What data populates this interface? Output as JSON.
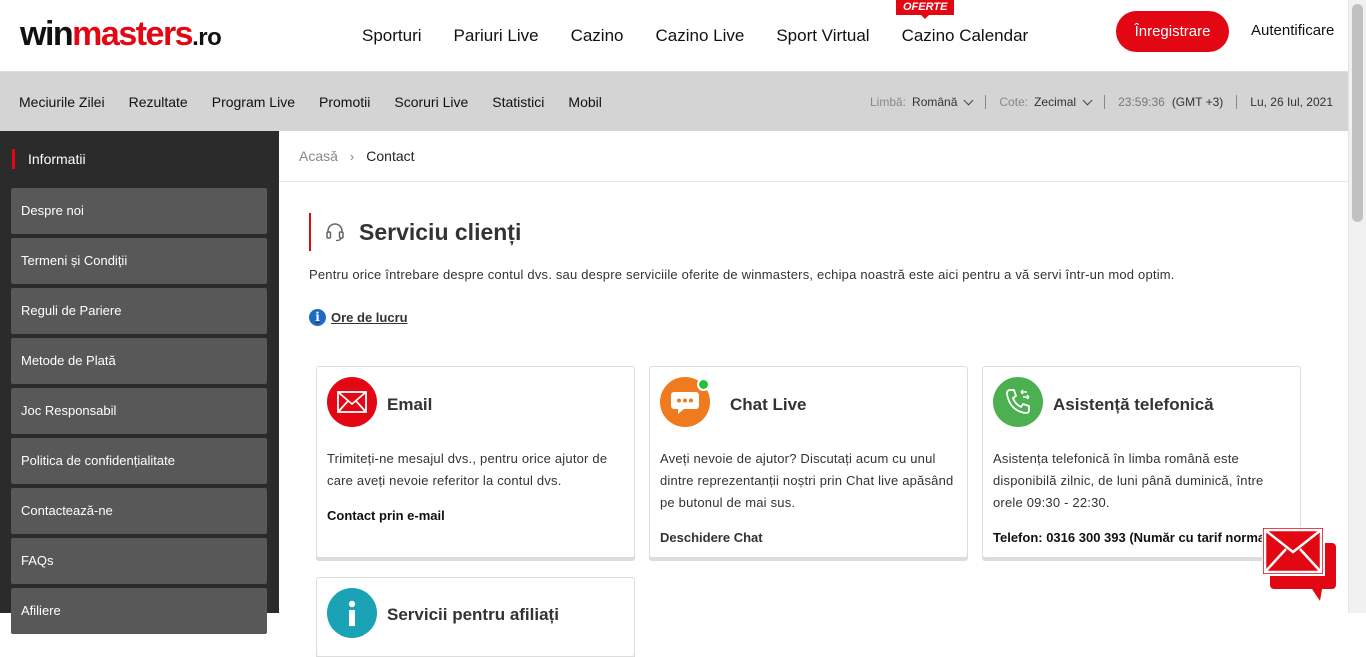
{
  "header": {
    "logo": {
      "part1": "win",
      "part2": "masters",
      "part3": ".ro"
    },
    "nav": [
      "Sporturi",
      "Pariuri Live",
      "Cazino",
      "Cazino Live",
      "Sport Virtual",
      "Cazino Calendar"
    ],
    "badge": "OFERTE",
    "register_label": "Înregistrare",
    "login_label": "Autentificare"
  },
  "subheader": {
    "nav": [
      "Meciurile Zilei",
      "Rezultate",
      "Program Live",
      "Promotii",
      "Scoruri Live",
      "Statistici",
      "Mobil"
    ],
    "language_label": "Limbă:",
    "language_value": "Română",
    "odds_label": "Cote:",
    "odds_value": "Zecimal",
    "time": "23:59:36",
    "timezone": "(GMT +3)",
    "date": "Lu, 26 Iul, 2021"
  },
  "sidebar": {
    "title": "Informatii",
    "items": [
      "Despre noi",
      "Termeni și Condiții",
      "Reguli de Pariere",
      "Metode de Plată",
      "Joc Responsabil",
      "Politica de confidențialitate",
      "Contactează-ne",
      "FAQs",
      "Afiliere"
    ]
  },
  "breadcrumb": {
    "home": "Acasă",
    "current": "Contact"
  },
  "section": {
    "title": "Serviciu clienți",
    "description": "Pentru orice întrebare despre contul dvs. sau despre serviciile oferite de winmasters, echipa noastră este aici pentru a vă servi într-un mod optim.",
    "hours_link": "Ore de lucru"
  },
  "cards": [
    {
      "title": "Email",
      "text": "Trimiteți-ne mesajul dvs., pentru orice ajutor de care aveți nevoie referitor la contul dvs.",
      "link": "Contact prin e-mail",
      "icon": "envelope-icon",
      "color": "#e30613"
    },
    {
      "title": "Chat Live",
      "text": "Aveți nevoie de ajutor? Discutați acum cu unul dintre reprezentanții noștri prin Chat live apăsând pe butonul de mai sus.",
      "link": "Deschidere Chat",
      "icon": "chat-bubble-icon",
      "color": "#f07a1e",
      "status": "online"
    },
    {
      "title": "Asistență telefonică",
      "text": "Asistența telefonică în limba română este disponibilă zilnic, de luni până duminică, între orele 09:30 - 22:30.",
      "link": "Telefon: 0316 300 393 (Număr cu tarif normal)",
      "icon": "phone-icon",
      "color": "#4caf50"
    },
    {
      "title": "Servicii pentru afiliați",
      "icon": "info-icon",
      "color": "#1aa3b5"
    }
  ],
  "colors": {
    "brand_red": "#e30613",
    "sidebar_bg": "#2b2b2b",
    "sidebar_item": "#585858",
    "subbar_bg": "#d4d4d4"
  }
}
